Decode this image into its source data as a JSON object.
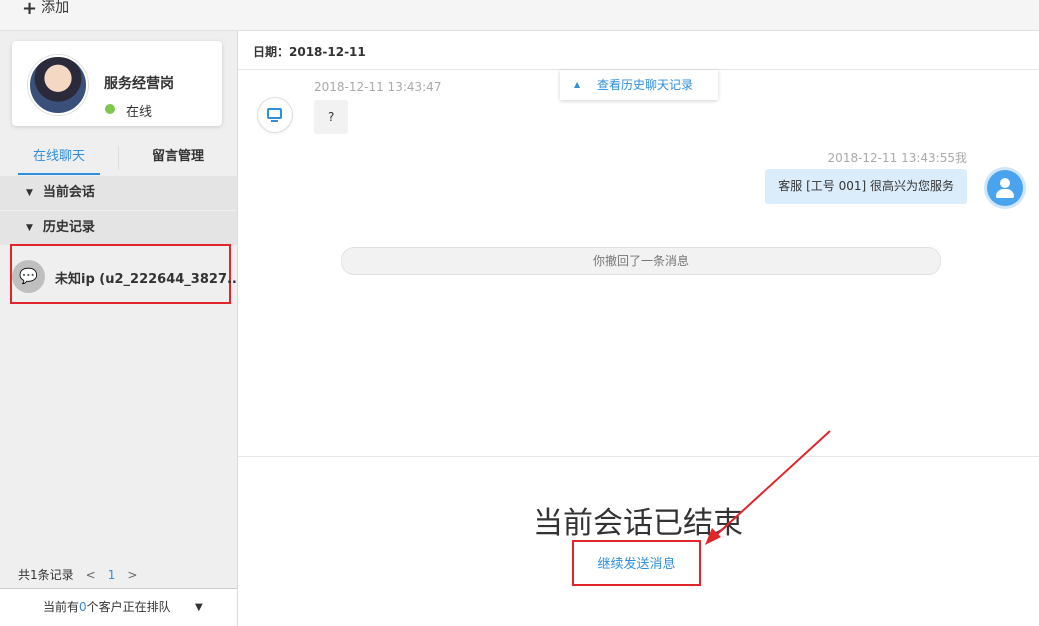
{
  "toolbar": {
    "add_label": "添加"
  },
  "profile": {
    "name": "服务经营岗",
    "status": "在线"
  },
  "tabs": [
    {
      "label": "在线聊天",
      "active": true
    },
    {
      "label": "留言管理",
      "active": false
    }
  ],
  "sections": {
    "current": "当前会话",
    "history": "历史记录"
  },
  "session": {
    "title": "未知ip (u2_222644_3827..."
  },
  "pager": {
    "summary": "共1条记录",
    "prev": "<",
    "page": "1",
    "next": ">"
  },
  "queue": {
    "prefix": "当前有",
    "count": "0",
    "suffix": "个客户正在排队"
  },
  "chat": {
    "date": "日期：2018-12-11",
    "history_link": "查看历史聊天记录",
    "visitor_time": "2018-12-11 13:43:47",
    "visitor_message": "?",
    "agent_time": "2018-12-11 13:43:55我",
    "agent_message": "客服 [工号 001] 很高兴为您服务",
    "recall_notice": "你撤回了一条消息"
  },
  "footer": {
    "ended": "当前会话已结束",
    "continue_label": "继续发送消息"
  },
  "colors": {
    "accent": "#2f8fde",
    "highlight": "#e0262b",
    "online": "#7ec74f"
  }
}
